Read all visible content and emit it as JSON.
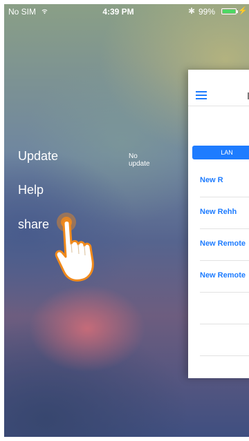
{
  "status_bar": {
    "carrier": "No SIM",
    "time": "4:39 PM",
    "battery_percent": "99%",
    "battery_color": "#4cd964"
  },
  "side_menu": {
    "items": [
      {
        "label": "Update",
        "status": "No update"
      },
      {
        "label": "Help"
      },
      {
        "label": "share"
      }
    ]
  },
  "panel": {
    "accent_color": "#1e7cff",
    "menu_icon": "hamburger-icon",
    "tab": "LAN",
    "rows": [
      "New R",
      "New Rehh",
      "New Remote",
      "New Remote",
      "",
      ""
    ]
  },
  "overlay": {
    "icon": "tap-hand-icon",
    "tap_color": "#f08a1c"
  }
}
